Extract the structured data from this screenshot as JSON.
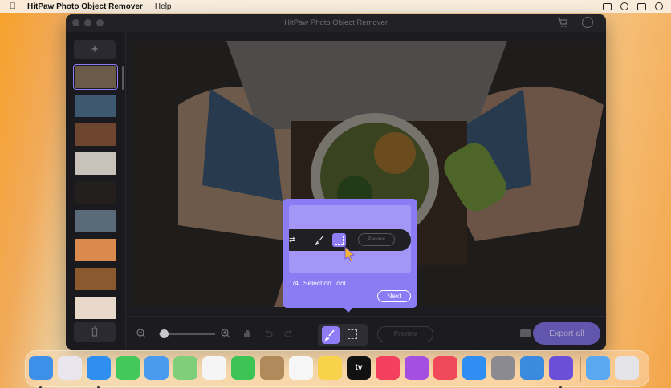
{
  "menubar": {
    "apple_icon": "apple-logo-icon",
    "app_name": "HitPaw Photo Object Remover",
    "menu_help": "Help",
    "status_icons": [
      "battery-icon",
      "search-icon",
      "control-center-icon",
      "siri-icon"
    ]
  },
  "window": {
    "title": "HitPaw Photo Object Remover",
    "cart_icon": "cart-icon",
    "user_icon": "user-icon"
  },
  "sidebar": {
    "add_label": "+",
    "thumbnails": [
      {
        "name": "food-bowl-photo",
        "color": "#6a5a48",
        "selected": true
      },
      {
        "name": "night-scene-photo",
        "color": "#3e5870"
      },
      {
        "name": "indoor-photo",
        "color": "#6e4630"
      },
      {
        "name": "beach-photo",
        "color": "#c9c2ba"
      },
      {
        "name": "dark-lights-photo",
        "color": "#221f1d"
      },
      {
        "name": "car-photo",
        "color": "#5a6a78"
      },
      {
        "name": "sunset-photo",
        "color": "#d98a4c"
      },
      {
        "name": "warm-room-photo",
        "color": "#8a5a2e"
      },
      {
        "name": "light-photo",
        "color": "#e7d8c9"
      }
    ]
  },
  "toolbar": {
    "zoom_out_icon": "zoom-out-icon",
    "zoom_in_icon": "zoom-in-icon",
    "hand_icon": "hand-icon",
    "undo_icon": "undo-icon",
    "redo_icon": "redo-icon",
    "brush_icon": "brush-icon",
    "rect_select_icon": "rectangle-select-icon",
    "preview_label": "Preview",
    "folder_icon": "folder-icon",
    "export_label": "Export all",
    "zoom_level": 0.05
  },
  "tooltip": {
    "step": "1/4",
    "text": "Selection Tool.",
    "next_label": "Next",
    "demo_preview_label": "Preview"
  },
  "dock": {
    "apps": [
      {
        "name": "finder-icon",
        "color": "#3d8fe8",
        "running": true
      },
      {
        "name": "launchpad-icon",
        "color": "#e9e6f0"
      },
      {
        "name": "safari-icon",
        "color": "#2f8ff0",
        "running": true
      },
      {
        "name": "messages-icon",
        "color": "#43c85a"
      },
      {
        "name": "mail-icon",
        "color": "#4a9af0"
      },
      {
        "name": "maps-icon",
        "color": "#7fcf7a"
      },
      {
        "name": "photos-icon",
        "color": "#f5f5f5"
      },
      {
        "name": "facetime-icon",
        "color": "#3cc455"
      },
      {
        "name": "contacts-icon",
        "color": "#b08a5a"
      },
      {
        "name": "reminders-icon",
        "color": "#f6f6f6"
      },
      {
        "name": "notes-icon",
        "color": "#f7d24a"
      },
      {
        "name": "apple-tv-icon",
        "color": "#111111"
      },
      {
        "name": "music-icon",
        "color": "#f43f5e"
      },
      {
        "name": "podcasts-icon",
        "color": "#a54fe0"
      },
      {
        "name": "news-icon",
        "color": "#f04a5a"
      },
      {
        "name": "app-store-icon",
        "color": "#2e8ef2"
      },
      {
        "name": "system-settings-icon",
        "color": "#8a8a90"
      },
      {
        "name": "hitpaw-icon",
        "color": "#3a8be0"
      },
      {
        "name": "photo-object-remover-icon",
        "color": "#6b4fd8",
        "running": true
      },
      {
        "name": "downloads-folder-icon",
        "color": "#5aa9f0"
      },
      {
        "name": "trash-icon",
        "color": "#e4e4e8"
      }
    ],
    "tv_label": "tv"
  },
  "colors": {
    "accent": "#8f7cf7",
    "tooltip": "#8b7cf3",
    "window_bg": "#1c1c20"
  }
}
